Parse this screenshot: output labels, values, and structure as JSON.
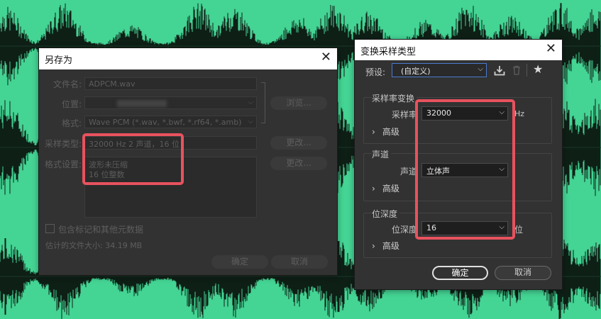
{
  "save_as_dialog": {
    "title": "另存为",
    "filename_label": "文件名:",
    "filename_value": "ADPCM.wav",
    "location_label": "位置:",
    "browse_button": "浏览...",
    "format_label": "格式:",
    "format_value": "Wave PCM (*.wav, *.bwf, *.rf64, *.amb)",
    "sample_type_label": "采样类型:",
    "sample_type_value": "32000 Hz 2 声道，16 位",
    "change_button": "更改...",
    "format_settings_label": "格式设置:",
    "format_settings_line1": "波形未压缩",
    "format_settings_line2": "16 位整数",
    "change_button_2": "更改...",
    "include_markers_label": "包含标记和其他元数据",
    "estimated_size": "估计的文件大小: 34.19 MB",
    "ok_button": "确定",
    "cancel_button": "取消"
  },
  "convert_dialog": {
    "title": "变换采样类型",
    "preset_label": "预设:",
    "preset_value": "(自定义)",
    "sample_rate_section": "采样率变换",
    "sample_rate_label": "采样率",
    "sample_rate_value": "32000",
    "sample_rate_unit": "Hz",
    "advanced_1": "高级",
    "channels_section": "声道",
    "channels_label": "声道",
    "channels_value": "立体声",
    "advanced_2": "高级",
    "bit_depth_section": "位深度",
    "bit_depth_label": "位深度",
    "bit_depth_value": "16",
    "bit_depth_unit": "位",
    "advanced_3": "高级",
    "ok_button": "确定",
    "cancel_button": "取消"
  },
  "icons": {
    "close": "close-icon",
    "dropdown": "chevron-down-icon",
    "save_preset": "download-icon",
    "delete_preset": "trash-icon",
    "favorite": "star-icon",
    "advanced": "chevron-right-icon"
  },
  "colors": {
    "background": "#44d494",
    "highlight": "#e8525e",
    "dialog": "#323232"
  }
}
